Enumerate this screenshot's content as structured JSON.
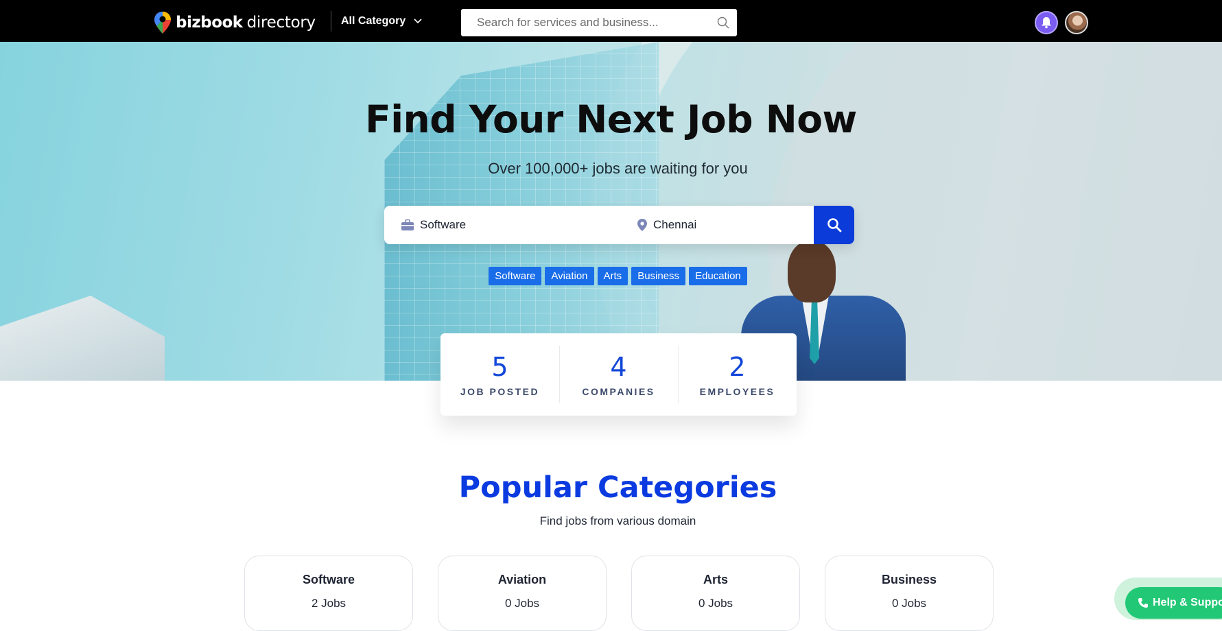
{
  "header": {
    "logo_main": "bizbook",
    "logo_sub": "directory",
    "category_label": "All Category",
    "search_placeholder": "Search for services and business..."
  },
  "hero": {
    "title": "Find Your Next Job Now",
    "subtitle": "Over 100,000+ jobs are waiting for you",
    "job_field_value": "Software",
    "location_field_value": "Chennai",
    "tags": [
      "Software",
      "Aviation",
      "Arts",
      "Business",
      "Education"
    ]
  },
  "stats": [
    {
      "value": "5",
      "label": "JOB POSTED"
    },
    {
      "value": "4",
      "label": "COMPANIES"
    },
    {
      "value": "2",
      "label": "EMPLOYEES"
    }
  ],
  "popular": {
    "title": "Popular Categories",
    "subtitle": "Find jobs from various domain",
    "categories": [
      {
        "name": "Software",
        "count": "2 Jobs"
      },
      {
        "name": "Aviation",
        "count": "0 Jobs"
      },
      {
        "name": "Arts",
        "count": "0 Jobs"
      },
      {
        "name": "Business",
        "count": "0 Jobs"
      }
    ]
  },
  "help": {
    "label": "Help & Support"
  },
  "icons": {
    "logo": "map-pin-icon",
    "category": "chevron-down-icon",
    "search": "search-icon",
    "notifications": "bell-icon",
    "job": "briefcase-icon",
    "location": "location-pin-icon",
    "help": "phone-icon"
  },
  "colors": {
    "accent": "#0b3bd8",
    "tag": "#1a6de8",
    "help": "#22c876",
    "notif": "#7b5cf2"
  }
}
